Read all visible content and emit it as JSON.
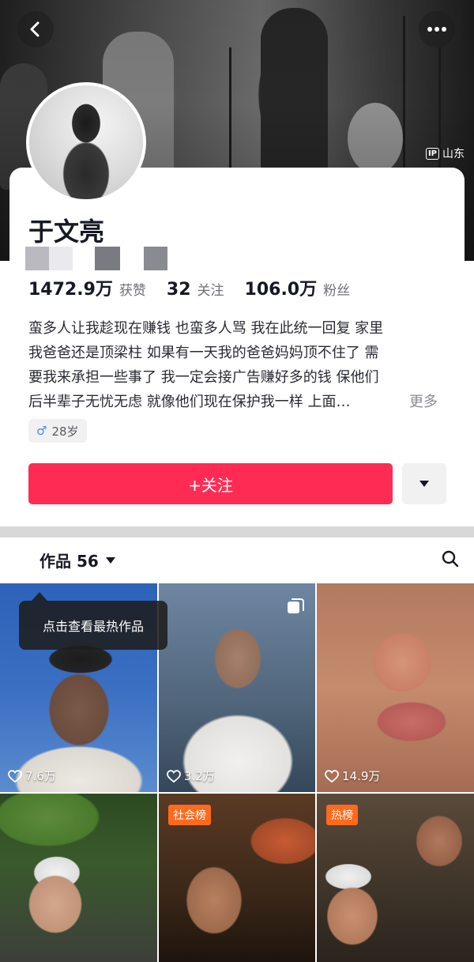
{
  "header": {
    "ip_badge": "IP",
    "ip_location": "山东"
  },
  "profile": {
    "name": "于文亮",
    "stats": [
      {
        "value": "1472.9万",
        "label": "获赞"
      },
      {
        "value": "32",
        "label": "关注"
      },
      {
        "value": "106.0万",
        "label": "粉丝"
      }
    ],
    "bio_lines": [
      "蛮多人让我趁现在赚钱 也蛮多人骂 我在此统一回复 家里",
      "我爸爸还是顶梁柱  如果有一天我的爸爸妈妈顶不住了 需",
      "要我来承担一些事了  我一定会接广告赚好多的钱 保他们",
      "后半辈子无忧无虑  就像他们现在保护我一样 上面…"
    ],
    "bio_more": "更多",
    "gender_symbol": "♂",
    "age": "28岁",
    "follow_label": "+关注"
  },
  "works": {
    "title": "作品 56",
    "tooltip": "点击查看最热作品",
    "tiles": [
      {
        "likes": "7.6万",
        "badge": ""
      },
      {
        "likes": "3.2万",
        "badge": ""
      },
      {
        "likes": "14.9万",
        "badge": ""
      },
      {
        "likes": "",
        "badge": ""
      },
      {
        "likes": "",
        "badge": "社会榜"
      },
      {
        "likes": "",
        "badge": "热榜"
      }
    ]
  },
  "colors": {
    "accent": "#fe2c55",
    "rank_badge": "#ff6a1c",
    "male": "#3f8ef5"
  }
}
